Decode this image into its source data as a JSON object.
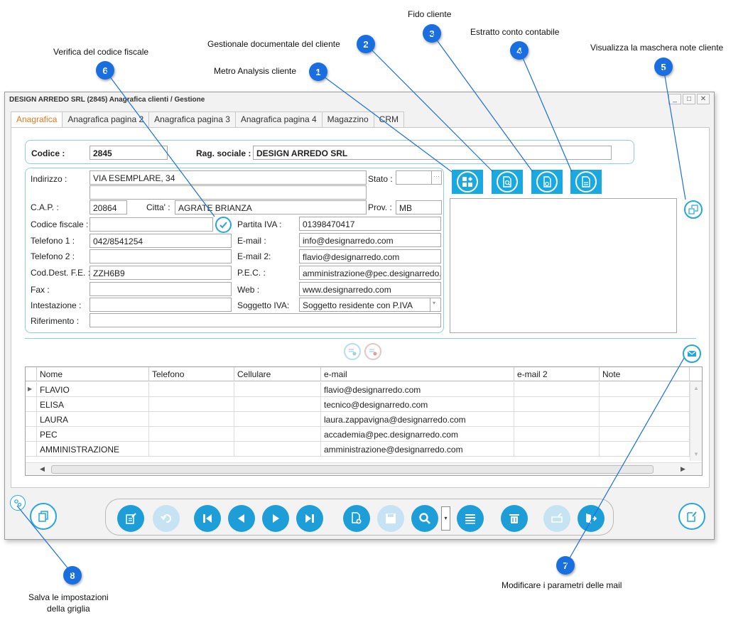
{
  "annotations": [
    {
      "num": "1",
      "text": "Metro Analysis cliente"
    },
    {
      "num": "2",
      "text": "Gestionale documentale del cliente"
    },
    {
      "num": "3",
      "text": "Fido cliente"
    },
    {
      "num": "4",
      "text": "Estratto conto contabile"
    },
    {
      "num": "5",
      "text": "Visualizza la maschera note cliente"
    },
    {
      "num": "6",
      "text": "Verifica del codice fiscale"
    },
    {
      "num": "7",
      "text": "Modificare i parametri delle mail"
    },
    {
      "num": "8",
      "text": "Salva le impostazioni\ndella griglia"
    }
  ],
  "window": {
    "title": "DESIGN ARREDO SRL (2845) Anagrafica clienti / Gestione",
    "controls": [
      "_",
      "□",
      "✕"
    ]
  },
  "tabs": [
    "Anagrafica",
    "Anagrafica pagina 2",
    "Anagrafica pagina 3",
    "Anagrafica pagina 4",
    "Magazzino",
    "CRM"
  ],
  "header": {
    "codice_label": "Codice :",
    "codice_value": "2845",
    "ragsoc_label": "Rag. sociale :",
    "ragsoc_value": "DESIGN ARREDO SRL"
  },
  "form": {
    "indirizzo_label": "Indirizzo :",
    "indirizzo_value": "VIA ESEMPLARE, 34",
    "indirizzo2_value": "",
    "stato_label": "Stato :",
    "stato_value": "",
    "cap_label": "C.A.P. :",
    "cap_value": "20864",
    "citta_label": "Citta' :",
    "citta_value": "AGRATE BRIANZA",
    "prov_label": "Prov. :",
    "prov_value": "MB",
    "cf_label": "Codice fiscale :",
    "cf_value": "",
    "piva_label": "Partita IVA :",
    "piva_value": "01398470417",
    "tel1_label": "Telefono 1 :",
    "tel1_value": "042/8541254",
    "email_label": "E-mail :",
    "email_value": "info@designarredo.com",
    "tel2_label": "Telefono 2 :",
    "tel2_value": "",
    "email2_label": "E-mail 2:",
    "email2_value": "flavio@designarredo.com",
    "coddest_label": "Cod.Dest. F.E. :",
    "coddest_value": "ZZH6B9",
    "pec_label": "P.E.C. :",
    "pec_value": "amministrazione@pec.designarredo.",
    "fax_label": "Fax :",
    "fax_value": "",
    "web_label": "Web :",
    "web_value": "www.designarredo.com",
    "intest_label": "Intestazione :",
    "intest_value": "",
    "sogg_label": "Soggetto IVA:",
    "sogg_value": "Soggetto residente con P.IVA",
    "rif_label": "Riferimento :",
    "rif_value": ""
  },
  "contacts": {
    "columns": [
      "Nome",
      "Telefono",
      "Cellulare",
      "e-mail",
      "e-mail 2",
      "Note"
    ],
    "rows": [
      {
        "nome": "FLAVIO",
        "telefono": "",
        "cellulare": "",
        "email": "flavio@designarredo.com",
        "email2": "",
        "note": ""
      },
      {
        "nome": "ELISA",
        "telefono": "",
        "cellulare": "",
        "email": "tecnico@designarredo.com",
        "email2": "",
        "note": ""
      },
      {
        "nome": "LAURA",
        "telefono": "",
        "cellulare": "",
        "email": "laura.zappavigna@designarredo.com",
        "email2": "",
        "note": ""
      },
      {
        "nome": "PEC",
        "telefono": "",
        "cellulare": "",
        "email": "accademia@pec.designarredo.com",
        "email2": "",
        "note": ""
      },
      {
        "nome": "AMMINISTRAZIONE",
        "telefono": "",
        "cellulare": "",
        "email": "amministrazione@designarredo.com",
        "email2": "",
        "note": ""
      }
    ]
  },
  "colors": {
    "accent": "#19a9e0",
    "badge": "#1a6fe0",
    "tab_active": "#e07a1f"
  }
}
